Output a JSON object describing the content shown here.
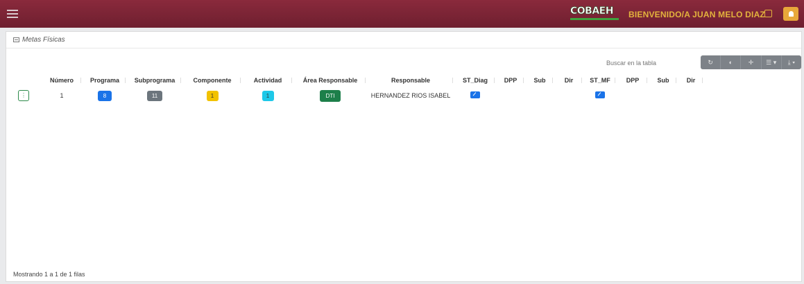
{
  "navbar": {
    "logo_text": "COBAEH",
    "welcome": "BIENVENIDO/A JUAN MELO DIAZ",
    "colors": {
      "bar": "#7a2434",
      "accent": "#e3b33d",
      "bell": "#e8a73a"
    }
  },
  "card": {
    "title": "Metas Físicas",
    "search_placeholder": "Buscar en la tabla",
    "toolbar": {
      "refresh": "↻",
      "toggle": "◐",
      "fullscreen": "✛",
      "columns": "☰ ▾",
      "export": "⤓ ▾"
    }
  },
  "table": {
    "headers": [
      "",
      "Número",
      "Programa",
      "Subprograma",
      "Componente",
      "Actividad",
      "Área Responsable",
      "Responsable",
      "ST_Diag",
      "DPP",
      "Sub",
      "Dir",
      "ST_MF",
      "DPP",
      "Sub",
      "Dir"
    ],
    "rows": [
      {
        "options": "⋮",
        "numero": "1",
        "programa": "8",
        "subprograma": "11",
        "componente": "1",
        "actividad": "1",
        "area": "DTI",
        "responsable": "HERNANDEZ RIOS ISABEL"
      }
    ]
  },
  "footer": {
    "text": "Mostrando 1 a 1 de 1 filas"
  }
}
